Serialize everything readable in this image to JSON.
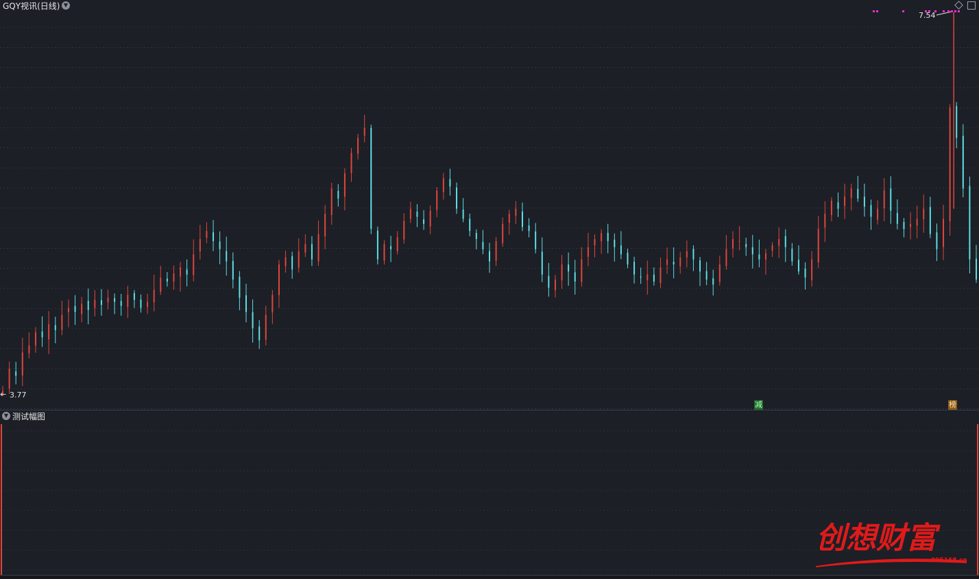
{
  "header": {
    "title": "GQY视讯(日线)",
    "indicator_title": "测试幅图"
  },
  "markers": {
    "high_label": "7.54",
    "low_label": "3.77",
    "badge_reduce": "减",
    "badge_list": "榜"
  },
  "logo": {
    "brand": "创想财富",
    "site": "995168.cn"
  },
  "colors": {
    "background": "#1c1f26",
    "up": "#e0463c",
    "down": "#5ee0e6",
    "grid": "#3a3f4a",
    "magenta": "#ff2bd6",
    "badge_reduce_bg": "#1f6b2e",
    "badge_list_bg": "#8a5a1a",
    "logo_red": "#e01a1a"
  },
  "chart_data": {
    "type": "candlestick",
    "title": "GQY视讯(日线)",
    "ylim": [
      3.77,
      7.54
    ],
    "high": 7.54,
    "low": 3.77,
    "grid": true,
    "series": [
      {
        "name": "close",
        "values": [
          3.8,
          4.02,
          3.95,
          4.18,
          4.25,
          4.38,
          4.33,
          4.46,
          4.4,
          4.55,
          4.62,
          4.58,
          4.66,
          4.6,
          4.7,
          4.65,
          4.72,
          4.68,
          4.64,
          4.75,
          4.7,
          4.62,
          4.68,
          4.8,
          4.92,
          4.88,
          4.96,
          5.02,
          4.95,
          5.15,
          5.3,
          5.38,
          5.28,
          5.2,
          5.08,
          4.9,
          4.72,
          4.58,
          4.42,
          4.3,
          4.55,
          4.75,
          5.05,
          5.12,
          5.0,
          5.18,
          5.25,
          5.1,
          5.35,
          5.55,
          5.8,
          5.7,
          5.95,
          6.15,
          6.3,
          6.4,
          5.4,
          5.1,
          5.25,
          5.2,
          5.32,
          5.48,
          5.6,
          5.52,
          5.45,
          5.58,
          5.78,
          5.9,
          5.82,
          5.6,
          5.5,
          5.38,
          5.3,
          5.2,
          5.08,
          5.28,
          5.45,
          5.55,
          5.6,
          5.42,
          5.38,
          5.2,
          4.95,
          4.82,
          4.9,
          5.05,
          4.98,
          4.88,
          5.1,
          5.22,
          5.3,
          5.36,
          5.28,
          5.22,
          5.15,
          5.05,
          4.95,
          4.92,
          4.95,
          4.88,
          5.02,
          5.1,
          5.05,
          5.12,
          5.18,
          5.1,
          4.98,
          4.9,
          4.85,
          5.05,
          5.2,
          5.3,
          5.28,
          5.22,
          5.15,
          5.1,
          5.16,
          5.24,
          5.3,
          5.22,
          5.08,
          4.98,
          4.92,
          5.1,
          5.4,
          5.55,
          5.68,
          5.6,
          5.72,
          5.8,
          5.7,
          5.62,
          5.52,
          5.6,
          5.78,
          5.58,
          5.45,
          5.4,
          5.45,
          5.5,
          5.6,
          5.35,
          5.2,
          5.5,
          6.6,
          6.3,
          5.8,
          5.1,
          4.9
        ]
      }
    ],
    "annotations": [
      "减",
      "榜"
    ]
  }
}
